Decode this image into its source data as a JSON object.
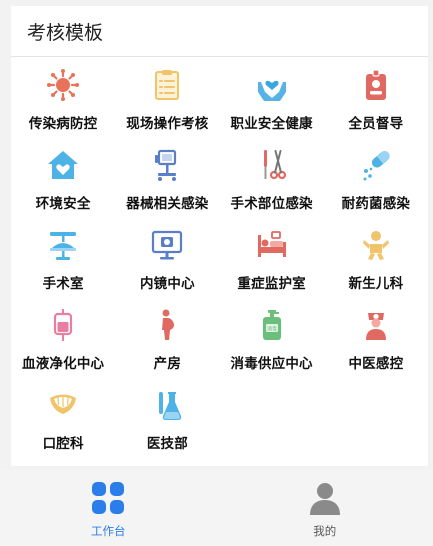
{
  "panel": {
    "title": "考核模板"
  },
  "modules": [
    {
      "label": "传染病防控",
      "icon": "virus-icon",
      "color": "#e8735a"
    },
    {
      "label": "现场操作考核",
      "icon": "clipboard-list-icon",
      "color": "#f0c46a"
    },
    {
      "label": "职业安全健康",
      "icon": "hands-heart-icon",
      "color": "#3aa6e0"
    },
    {
      "label": "全员督导",
      "icon": "id-badge-icon",
      "color": "#e06a62"
    },
    {
      "label": "环境安全",
      "icon": "house-heart-icon",
      "color": "#4db2e6"
    },
    {
      "label": "器械相关感染",
      "icon": "medical-device-icon",
      "color": "#5a7fc8"
    },
    {
      "label": "手术部位感染",
      "icon": "surgical-tools-icon",
      "color": "#e06a62"
    },
    {
      "label": "耐药菌感染",
      "icon": "pill-capsule-icon",
      "color": "#4db2e6"
    },
    {
      "label": "手术室",
      "icon": "surgical-light-icon",
      "color": "#4db2e6"
    },
    {
      "label": "内镜中心",
      "icon": "monitor-camera-icon",
      "color": "#5a7fc8"
    },
    {
      "label": "重症监护室",
      "icon": "hospital-bed-icon",
      "color": "#e06a62"
    },
    {
      "label": "新生儿科",
      "icon": "baby-icon",
      "color": "#f0c46a"
    },
    {
      "label": "血液净化中心",
      "icon": "blood-bag-icon",
      "color": "#e87fa0"
    },
    {
      "label": "产房",
      "icon": "pregnant-woman-icon",
      "color": "#e06a62"
    },
    {
      "label": "消毒供应中心",
      "icon": "sanitizer-bottle-icon",
      "color": "#6abf7a"
    },
    {
      "label": "中医感控",
      "icon": "nurse-icon",
      "color": "#e06a62"
    },
    {
      "label": "口腔科",
      "icon": "dental-icon",
      "color": "#f0c46a"
    },
    {
      "label": "医技部",
      "icon": "lab-flask-icon",
      "color": "#4db2e6"
    }
  ],
  "tabbar": {
    "tabs": [
      {
        "label": "工作台",
        "icon": "four-squares-icon",
        "active": true,
        "color": "#2b7de9"
      },
      {
        "label": "我的",
        "icon": "person-icon",
        "active": false,
        "color": "#8a8a8a"
      }
    ]
  }
}
